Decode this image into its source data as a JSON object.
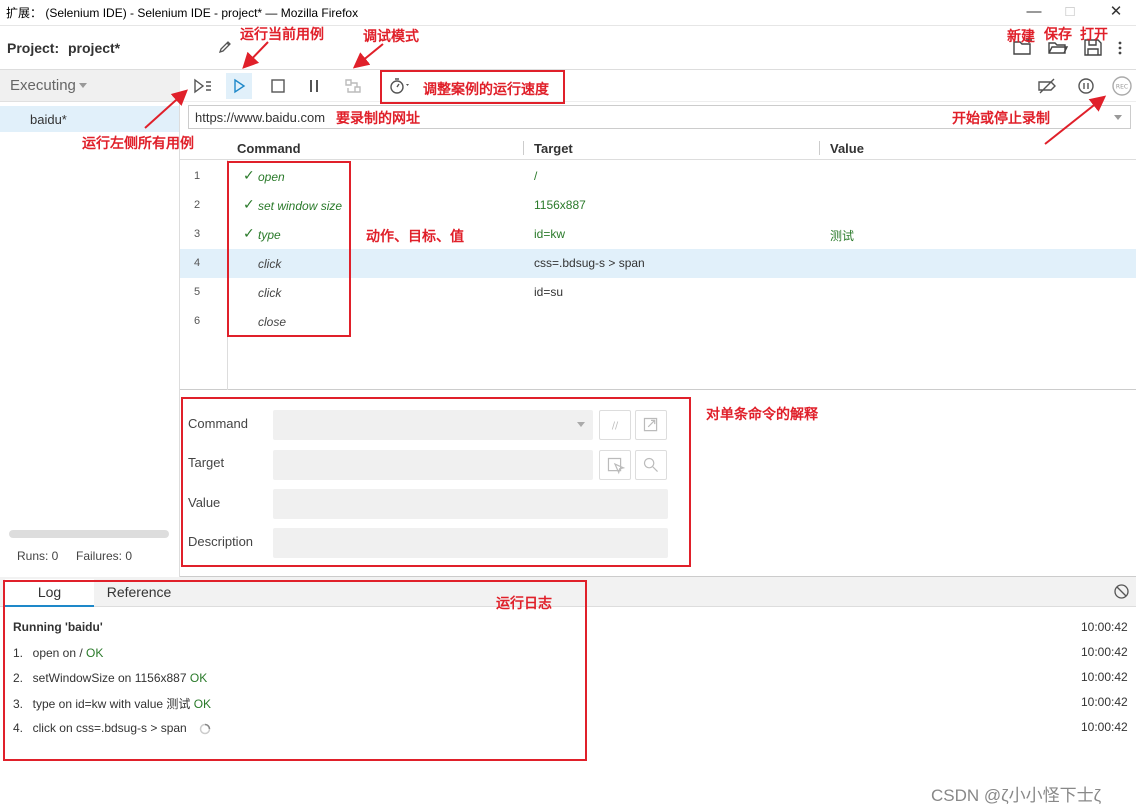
{
  "window": {
    "title": "扩展： (Selenium IDE) - Selenium IDE - project* — Mozilla Firefox",
    "minimize": "—",
    "maximize": "□",
    "close": "✕"
  },
  "project": {
    "label": "Project:",
    "name": "project*"
  },
  "sidebar": {
    "header": "Executing",
    "suite": "baidu*",
    "runs": "Runs: 0",
    "failures": "Failures: 0"
  },
  "url": {
    "value": "https://www.baidu.com"
  },
  "table": {
    "headers": {
      "command": "Command",
      "target": "Target",
      "value": "Value"
    },
    "rows": [
      {
        "num": "1",
        "command": "open",
        "target": "/",
        "value": "",
        "status": "ok"
      },
      {
        "num": "2",
        "command": "set window size",
        "target": "1156x887",
        "value": "",
        "status": "ok"
      },
      {
        "num": "3",
        "command": "type",
        "target": "id=kw",
        "value": "测试",
        "status": "ok"
      },
      {
        "num": "4",
        "command": "click",
        "target": "css=.bdsug-s > span",
        "value": "",
        "status": "running"
      },
      {
        "num": "5",
        "command": "click",
        "target": "id=su",
        "value": "",
        "status": "pending"
      },
      {
        "num": "6",
        "command": "close",
        "target": "",
        "value": "",
        "status": "pending"
      }
    ]
  },
  "editor": {
    "command_label": "Command",
    "target_label": "Target",
    "value_label": "Value",
    "description_label": "Description",
    "comment_icon_text": "//"
  },
  "log": {
    "tabs": {
      "log": "Log",
      "reference": "Reference"
    },
    "running": "Running 'baidu'",
    "running_time": "10:00:42",
    "entries": [
      {
        "num": "1.",
        "text": "open on / ",
        "ok": "OK",
        "time": "10:00:42"
      },
      {
        "num": "2.",
        "text": "setWindowSize on 1156x887 ",
        "ok": "OK",
        "time": "10:00:42"
      },
      {
        "num": "3.",
        "text": "type on id=kw with value 测试 ",
        "ok": "OK",
        "time": "10:00:42"
      },
      {
        "num": "4.",
        "text": "click on css=.bdsug-s > span",
        "ok": "",
        "time": "10:00:42"
      }
    ]
  },
  "annotations": {
    "run_current": "运行当前用例",
    "debug_mode": "调试模式",
    "new": "新建",
    "save": "保存",
    "open": "打开",
    "speed": "调整案例的运行速度",
    "record_url": "要录制的网址",
    "run_all": "运行左侧所有用例",
    "start_stop_record": "开始或停止录制",
    "action_target_value": "动作、目标、值",
    "command_explain": "对单条命令的解释",
    "run_log": "运行日志"
  },
  "watermark": "CSDN @ζ小小怪下士ζ",
  "colors": {
    "annotation": "#e0202a",
    "ok_green": "#2a7a2a",
    "selected_row": "#e1f0fa",
    "tab_underline": "#1e88c9"
  }
}
